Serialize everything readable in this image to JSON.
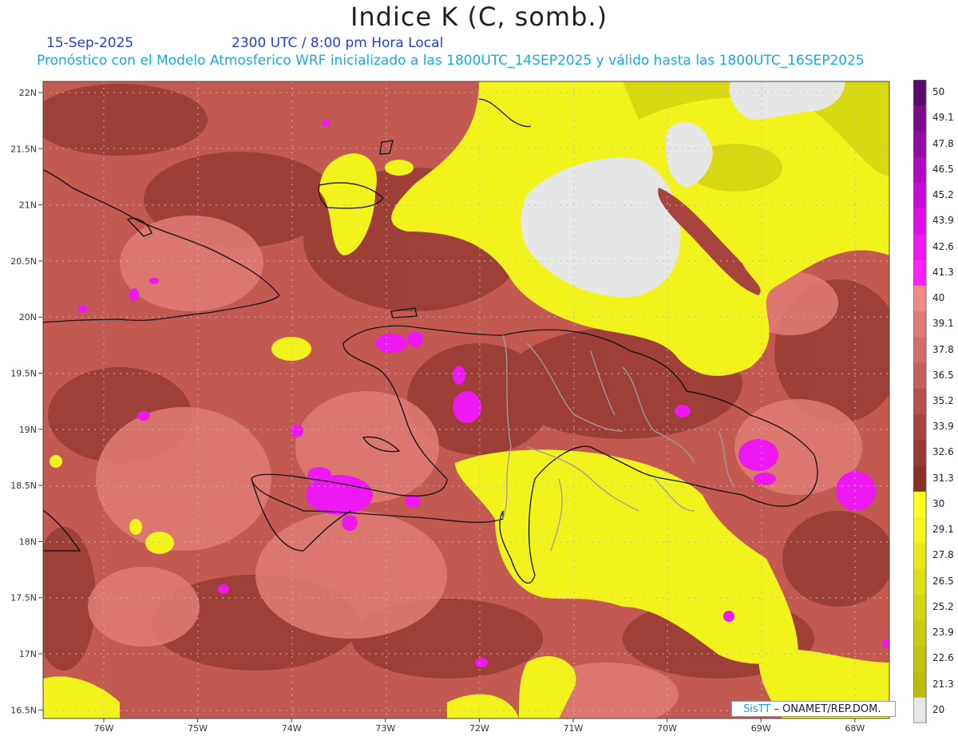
{
  "title": "Indice K (C, somb.)",
  "date": "15-Sep-2025",
  "time": "2300 UTC / 8:00 pm Hora Local",
  "forecast_note": "Pronóstico con el Modelo Atmosferico WRF inicializado a las 1800UTC_14SEP2025 y válido hasta las  1800UTC_16SEP2025",
  "credit": {
    "sis": "SisTT",
    "rest": "– ONAMET/REP.DOM."
  },
  "lat_labels": [
    "22N",
    "21.5N",
    "21N",
    "20.5N",
    "20N",
    "19.5N",
    "19N",
    "18.5N",
    "18N",
    "17.5N",
    "17N",
    "16.5N"
  ],
  "lon_labels": [
    "76W",
    "75W",
    "74W",
    "73W",
    "72W",
    "71W",
    "70W",
    "69W",
    "68W"
  ],
  "colorbar": {
    "labels": [
      "50",
      "49.1",
      "47.8",
      "46.5",
      "45.2",
      "43.9",
      "42.6",
      "41.3",
      "40",
      "39.1",
      "37.8",
      "36.5",
      "35.2",
      "33.9",
      "32.6",
      "31.3",
      "30",
      "29.1",
      "27.8",
      "26.5",
      "25.2",
      "23.9",
      "22.6",
      "21.3",
      "20"
    ],
    "colors": [
      "#5a0a6a",
      "#7a0a8a",
      "#950aa5",
      "#b00ac0",
      "#c80ad5",
      "#de10e6",
      "#ee18f2",
      "#ff22ff",
      "#f08a86",
      "#e07a76",
      "#d46c66",
      "#c85e58",
      "#b8504a",
      "#a8443e",
      "#983832",
      "#8a2e28",
      "#ffff20",
      "#f6f61c",
      "#eaea18",
      "#dede14",
      "#d4d410",
      "#cccc0e",
      "#c4c40c",
      "#bcbc0a",
      "#e6e6e6"
    ]
  },
  "legend_bands": [
    {
      "range": "20–30",
      "color": "#eded1a"
    },
    {
      "range": "30–40",
      "color": "#c85e58"
    },
    {
      "range": "40–50",
      "color": "#ee18f2"
    }
  ]
}
